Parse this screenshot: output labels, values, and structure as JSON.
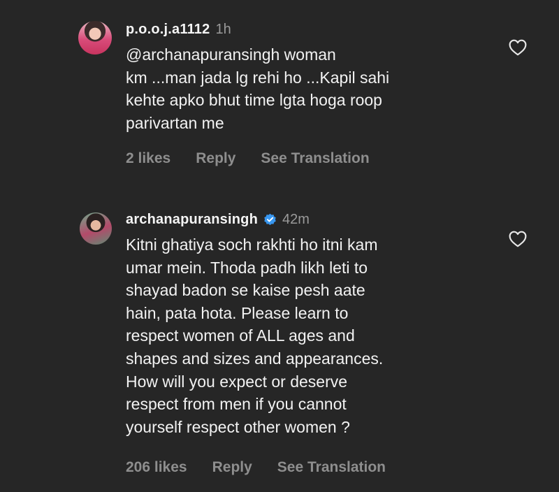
{
  "comments": [
    {
      "username": "p.o.o.j.a1112",
      "time": "1h",
      "text": "@archanapuransingh woman\nkm ...man jada lg rehi ho ...Kapil sahi\nkehte apko bhut time lgta hoga roop\nparivartan me",
      "likes": "2 likes",
      "reply_label": "Reply",
      "translate_label": "See Translation",
      "verified": false
    },
    {
      "username": "archanapuransingh",
      "time": "42m",
      "text": "Kitni ghatiya soch rakhti ho itni kam\numar mein. Thoda padh likh leti to\nshayad badon se kaise pesh aate\nhain, pata hota. Please learn to\nrespect women of ALL ages and\nshapes and sizes and appearances.\nHow will you expect or deserve\nrespect from men if you cannot\nyourself respect other women ?",
      "likes": "206 likes",
      "reply_label": "Reply",
      "translate_label": "See Translation",
      "verified": true
    }
  ],
  "icons": {
    "like": "heart-outline-icon",
    "verified": "verified-badge-icon",
    "verified_color": "#3897f0"
  }
}
